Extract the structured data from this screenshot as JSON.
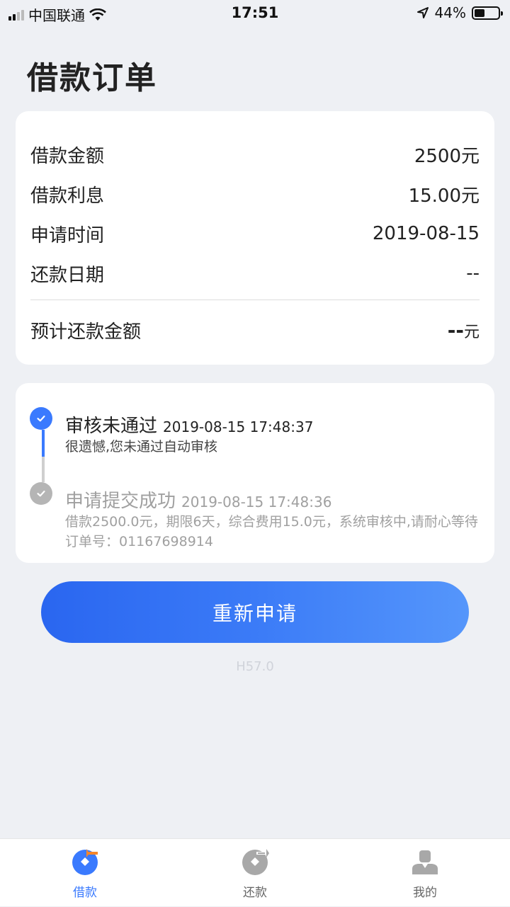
{
  "status_bar": {
    "carrier": "中国联通",
    "time": "17:51",
    "battery": "44%",
    "battery_level": 0.44
  },
  "page": {
    "title": "借款订单"
  },
  "summary": {
    "rows": [
      {
        "label": "借款金额",
        "value": "2500元"
      },
      {
        "label": "借款利息",
        "value": "15.00元"
      },
      {
        "label": "申请时间",
        "value": "2019-08-15"
      },
      {
        "label": "还款日期",
        "value": "--"
      }
    ],
    "total_label": "预计还款金额",
    "total_value": "--",
    "total_unit": "元"
  },
  "timeline": [
    {
      "title": "审核未通过",
      "time": "2019-08-15 17:48:37",
      "desc": "很遗憾,您未通过自动审核",
      "state": "active"
    },
    {
      "title": "申请提交成功",
      "time": "2019-08-15 17:48:36",
      "desc": "借款2500.0元，期限6天，综合费用15.0元，系统审核中,请耐心等待 订单号：01167698914",
      "state": "done"
    }
  ],
  "actions": {
    "retry_label": "重新申请"
  },
  "version": "H57.0",
  "tabbar": {
    "items": [
      {
        "label": "借款",
        "icon": "loan-icon",
        "active": true
      },
      {
        "label": "还款",
        "icon": "repay-icon",
        "active": false
      },
      {
        "label": "我的",
        "icon": "profile-icon",
        "active": false
      }
    ]
  },
  "colors": {
    "accent": "#3a7afe",
    "orange": "#f5862b",
    "inactive": "#a0a0a0",
    "background": "#eef0f4"
  }
}
